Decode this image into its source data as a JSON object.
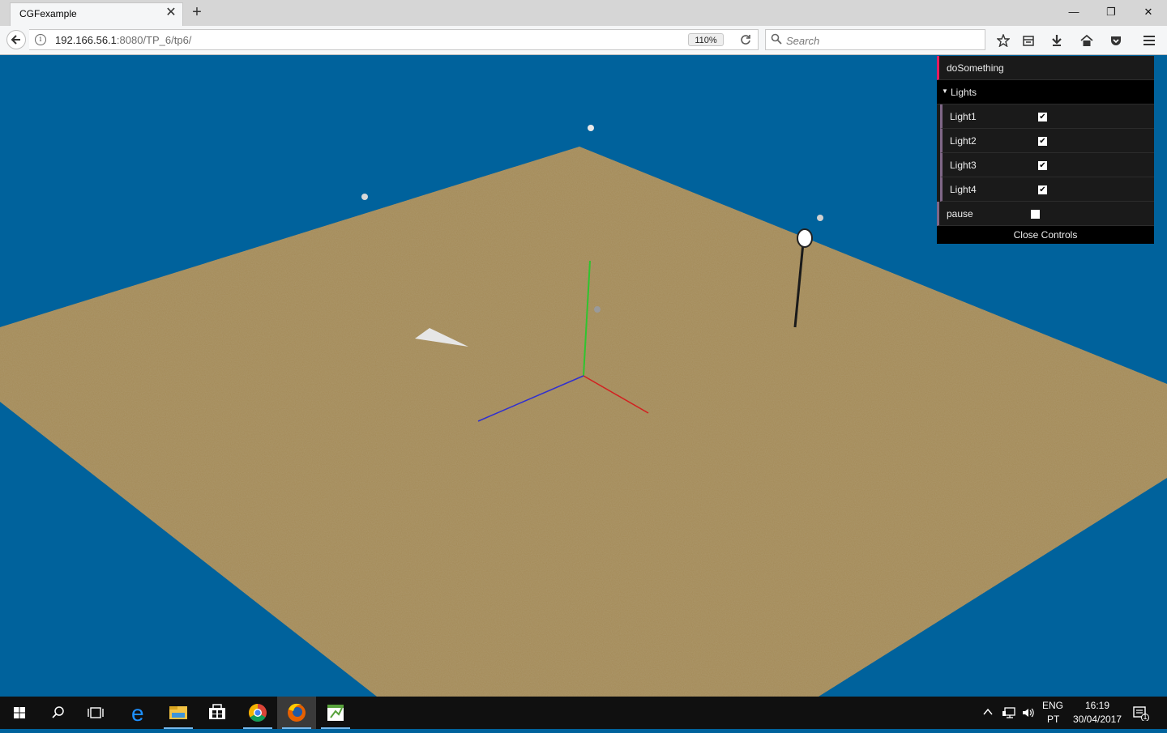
{
  "browser": {
    "tab_title": "CGFexample",
    "tab_close": "✕",
    "new_tab": "+",
    "url_host": "192.166.56.1",
    "url_rest": ":8080/TP_6/tp6/",
    "zoom": "110%",
    "search_placeholder": "Search",
    "window_controls": {
      "minimize": "—",
      "restore": "❐",
      "close": "✕"
    },
    "toolbar_icons": [
      "star-icon",
      "reading-list-icon",
      "download-icon",
      "home-icon",
      "pocket-icon",
      "menu-icon"
    ]
  },
  "gui": {
    "do_something": "doSomething",
    "lights_folder": "Lights",
    "lights": [
      {
        "label": "Light1",
        "checked": true
      },
      {
        "label": "Light2",
        "checked": true
      },
      {
        "label": "Light3",
        "checked": true
      },
      {
        "label": "Light4",
        "checked": true
      }
    ],
    "pause": {
      "label": "pause",
      "checked": false
    },
    "close_controls": "Close Controls"
  },
  "scene": {
    "background_color": "#00629c",
    "floor_color": "#a48a57",
    "axis_colors": {
      "x": "#d22020",
      "y": "#2fc42f",
      "z": "#3030d0"
    }
  },
  "taskbar": {
    "apps": [
      "windows-start-icon",
      "search-icon",
      "task-view-icon",
      "edge-icon",
      "file-explorer-icon",
      "store-icon",
      "chrome-icon",
      "firefox-icon",
      "notepad-icon"
    ],
    "lang_1": "ENG",
    "lang_2": "PT",
    "time": "16:19",
    "date": "30/04/2017",
    "notification_count": "1"
  }
}
